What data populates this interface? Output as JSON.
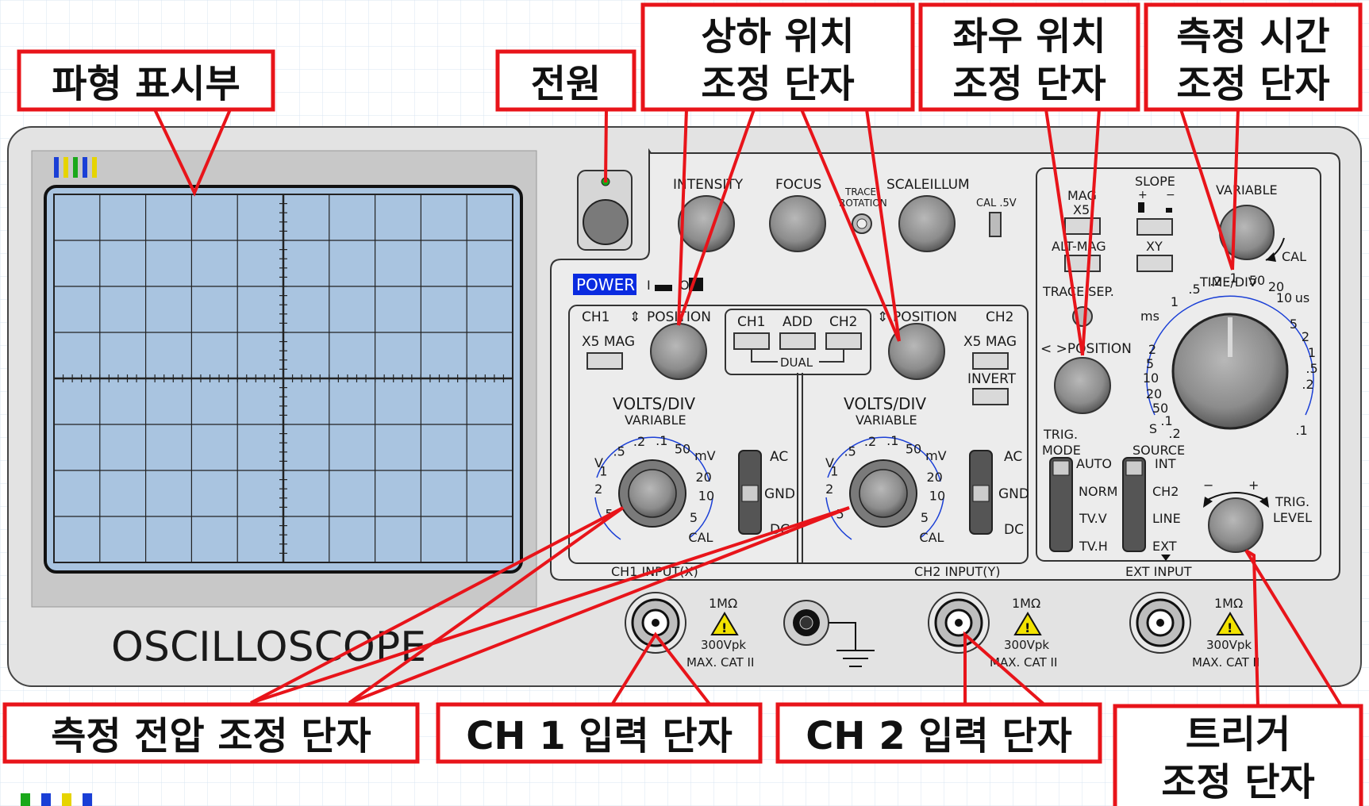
{
  "device": {
    "brand_text": "OSCILLOSCOPE",
    "power_badge": "POWER",
    "power_on": "I",
    "power_off": "O"
  },
  "callouts": {
    "screen": "파형 표시부",
    "power": "전원",
    "vpos_1": "상하 위치",
    "vpos_2": "조정 단자",
    "hpos_1": "좌우 위치",
    "hpos_2": "조정 단자",
    "time_1": "측정 시간",
    "time_2": "조정 단자",
    "volt": "측정 전압 조정 단자",
    "ch1in": "CH 1 입력 단자",
    "ch2in": "CH 2 입력 단자",
    "trig_1": "트리거",
    "trig_2": "조정 단자"
  },
  "top_row": {
    "intensity": "INTENSITY",
    "focus": "FOCUS",
    "trace_1": "TRACE",
    "trace_2": "ROTATION",
    "scale": "SCALEILLUM",
    "cal": "CAL .5V"
  },
  "ch1": {
    "label": "CH1",
    "position": "POSITION",
    "x5mag": "X5 MAG",
    "volts": "VOLTS/DIV",
    "variable": "VARIABLE",
    "input": "CH1 INPUT(X)"
  },
  "ch2": {
    "label": "CH2",
    "position": "POSITION",
    "x5mag": "X5 MAG",
    "invert": "INVERT",
    "volts": "VOLTS/DIV",
    "variable": "VARIABLE",
    "input": "CH2 INPUT(Y)"
  },
  "mode": {
    "ch1": "CH1",
    "add": "ADD",
    "ch2": "CH2",
    "dual": "DUAL"
  },
  "coupling": {
    "ac": "AC",
    "gnd": "GND",
    "dc": "DC"
  },
  "volt_scale": [
    "V",
    ".5",
    ".2",
    ".1",
    "50",
    "mV",
    "1",
    "2",
    "5",
    "20",
    "10",
    "5",
    "CAL"
  ],
  "sweep": {
    "mag": "MAG",
    "x5": "X5",
    "altmag": "ALT-MAG",
    "slope": "SLOPE",
    "plus": "+",
    "minus": "−",
    "xy": "XY",
    "variable": "VARIABLE",
    "cal": "CAL",
    "tracesep": "TRACE SEP.",
    "hposition": "< >POSITION",
    "timediv": "TIME/DIV"
  },
  "time_scale": [
    "ms",
    "1",
    ".5",
    ".2",
    ".1",
    "50",
    "20",
    "us",
    "10",
    "2",
    "5",
    "10",
    "20",
    "50",
    ".1",
    "S",
    ".2",
    "5",
    "2",
    "1",
    ".5",
    ".2",
    ".1"
  ],
  "trigger": {
    "trig": "TRIG.",
    "mode": "MODE",
    "source": "SOURCE",
    "auto": "AUTO",
    "norm": "NORM",
    "tvv": "TV.V",
    "tvh": "TV.H",
    "int": "INT",
    "ch2": "CH2",
    "line": "LINE",
    "ext": "EXT",
    "level_1": "TRIG.",
    "level_2": "LEVEL",
    "ext_input": "EXT INPUT",
    "minus": "−",
    "plus": "+"
  },
  "bnc_spec": {
    "imp": "1MΩ",
    "vpk": "300Vpk",
    "cat": "MAX. CAT II"
  },
  "colors": {
    "callout_red": "#e8141a",
    "screen_blue": "#a9c4e0",
    "panel_gray": "#dcdcdc",
    "power_badge": "#0a2be0",
    "scale_blue": "#1a3fd6"
  }
}
